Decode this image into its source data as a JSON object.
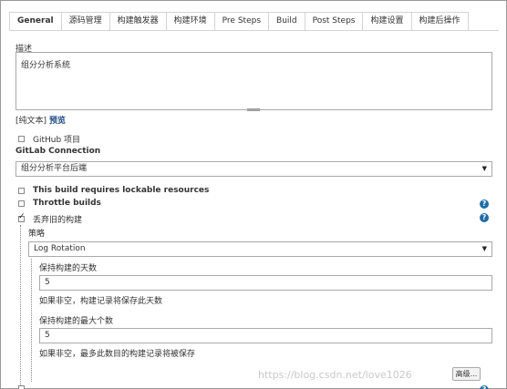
{
  "tabs": [
    "General",
    "源码管理",
    "构建触发器",
    "构建环境",
    "Pre Steps",
    "Build",
    "Post Steps",
    "构建设置",
    "构建后操作"
  ],
  "description": {
    "label": "描述",
    "value": "组分分析系统",
    "plain_text_label": "[纯文本]",
    "preview_link": "预览"
  },
  "github_project": {
    "label": "GitHub 项目",
    "checked": false
  },
  "gitlab": {
    "label": "GitLab Connection",
    "selected": "组分分析平台后端"
  },
  "lockable": {
    "label": "This build requires lockable resources",
    "checked": false
  },
  "throttle": {
    "label": "Throttle builds",
    "checked": false
  },
  "discard": {
    "label": "丢弃旧的构建",
    "checked": true,
    "strategy_label": "策略",
    "strategy_selected": "Log Rotation",
    "days_label": "保持构建的天数",
    "days_value": "5",
    "days_hint": "如果非空，构建记录将保存此天数",
    "max_label": "保持构建的最大个数",
    "max_value": "5",
    "max_hint": "如果非空，最多此数目的构建记录将被保存",
    "advanced_button": "高级..."
  },
  "watermark": "https://blog.csdn.net/love1026",
  "colors": {
    "link": "#204a87",
    "help": "#1e6ea7",
    "border": "#aaaaaa"
  },
  "icons": [
    "help-icon",
    "checkbox-icon",
    "dropdown-arrow-icon"
  ]
}
